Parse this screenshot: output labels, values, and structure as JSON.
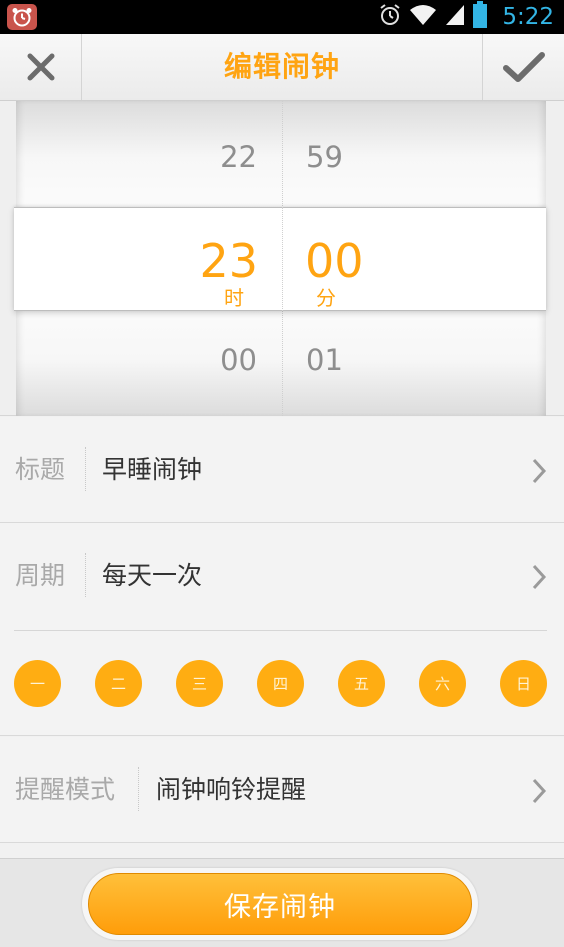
{
  "status_bar": {
    "time": "5:22"
  },
  "header": {
    "title": "编辑闹钟"
  },
  "picker": {
    "hour": {
      "prev": "22",
      "current": "23",
      "next": "00",
      "unit": "时"
    },
    "minute": {
      "prev": "59",
      "current": "00",
      "next": "01",
      "unit": "分"
    }
  },
  "settings": {
    "title": {
      "label": "标题",
      "value": "早睡闹钟"
    },
    "period": {
      "label": "周期",
      "value": "每天一次"
    },
    "weekdays": [
      "一",
      "二",
      "三",
      "四",
      "五",
      "六",
      "日"
    ],
    "reminder": {
      "label": "提醒模式",
      "value": "闹钟响铃提醒"
    }
  },
  "save_button": {
    "label": "保存闹钟"
  },
  "colors": {
    "accent": "#ffa412",
    "status_time": "#33b5e5"
  }
}
